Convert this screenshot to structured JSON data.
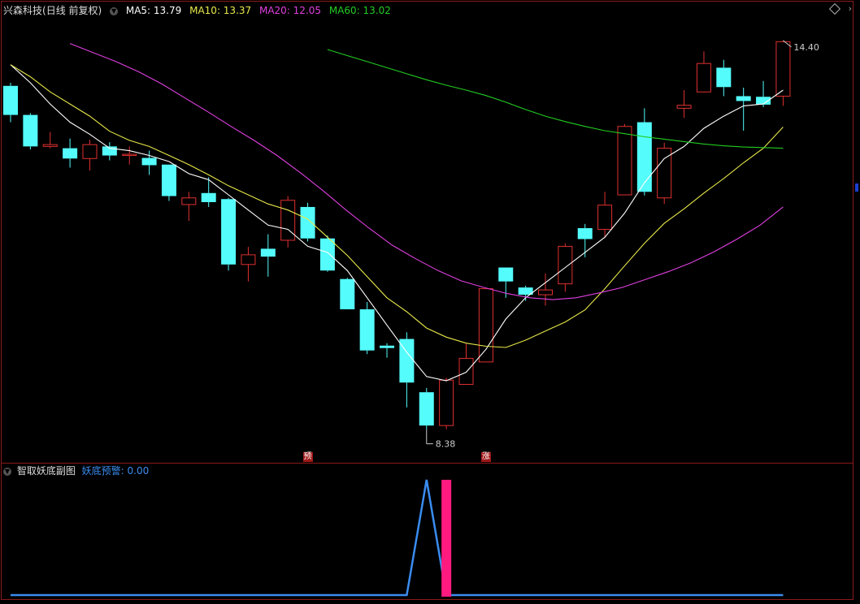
{
  "header": {
    "stock_name": "兴森科技",
    "period": "(日线 前复权)",
    "ma": [
      {
        "label": "MA5: 13.79",
        "color": "#ffffff"
      },
      {
        "label": "MA10: 13.37",
        "color": "#e8e84a"
      },
      {
        "label": "MA20: 12.05",
        "color": "#e040e0"
      },
      {
        "label": "MA60: 13.02",
        "color": "#22cc22"
      }
    ]
  },
  "price_marks": {
    "high": "14.40",
    "low": "8.38"
  },
  "signals": [
    {
      "label": "预",
      "index": 15
    },
    {
      "label": "涨",
      "index": 24
    }
  ],
  "sub_panel": {
    "title": "智取妖底副图",
    "indicator_label": "妖底预警: 0.00",
    "indicator_color": "#3a8cf0"
  },
  "colors": {
    "up": "#e03030",
    "down": "#54fcfc",
    "ma5": "#ffffff",
    "ma10": "#e8e84a",
    "ma20": "#e040e0",
    "ma60": "#22cc22",
    "frame": "#8b1a1a",
    "signal_bar": "#ff1a80"
  },
  "chart_data": {
    "type": "candlestick",
    "ylim": [
      8.0,
      15.2
    ],
    "candles": [
      {
        "o": 14.05,
        "c": 13.57,
        "h": 14.1,
        "l": 13.45
      },
      {
        "o": 13.57,
        "c": 13.05,
        "h": 13.6,
        "l": 13.0
      },
      {
        "o": 13.05,
        "c": 13.08,
        "h": 13.29,
        "l": 13.02
      },
      {
        "o": 13.02,
        "c": 12.85,
        "h": 13.18,
        "l": 12.7
      },
      {
        "o": 12.85,
        "c": 13.08,
        "h": 13.16,
        "l": 12.65
      },
      {
        "o": 13.05,
        "c": 12.9,
        "h": 13.12,
        "l": 12.82
      },
      {
        "o": 12.9,
        "c": 12.92,
        "h": 13.05,
        "l": 12.75
      },
      {
        "o": 12.86,
        "c": 12.74,
        "h": 12.98,
        "l": 12.58
      },
      {
        "o": 12.75,
        "c": 12.23,
        "h": 12.75,
        "l": 12.15
      },
      {
        "o": 12.09,
        "c": 12.2,
        "h": 12.3,
        "l": 11.82
      },
      {
        "o": 12.28,
        "c": 12.13,
        "h": 12.54,
        "l": 12.05
      },
      {
        "o": 12.18,
        "c": 11.1,
        "h": 12.2,
        "l": 11.0
      },
      {
        "o": 11.1,
        "c": 11.26,
        "h": 11.39,
        "l": 10.82
      },
      {
        "o": 11.36,
        "c": 11.23,
        "h": 11.6,
        "l": 10.9
      },
      {
        "o": 11.5,
        "c": 12.16,
        "h": 12.23,
        "l": 11.38
      },
      {
        "o": 12.05,
        "c": 11.53,
        "h": 12.12,
        "l": 11.48
      },
      {
        "o": 11.53,
        "c": 11.0,
        "h": 11.58,
        "l": 10.98
      },
      {
        "o": 10.86,
        "c": 10.36,
        "h": 10.88,
        "l": 10.36
      },
      {
        "o": 10.36,
        "c": 9.68,
        "h": 10.48,
        "l": 9.62
      },
      {
        "o": 9.76,
        "c": 9.72,
        "h": 9.8,
        "l": 9.56
      },
      {
        "o": 9.87,
        "c": 9.15,
        "h": 9.98,
        "l": 8.74
      },
      {
        "o": 8.99,
        "c": 8.44,
        "h": 9.06,
        "l": 8.38
      },
      {
        "o": 8.44,
        "c": 9.19,
        "h": 9.23,
        "l": 8.38
      },
      {
        "o": 9.12,
        "c": 9.55,
        "h": 9.79,
        "l": 9.12
      },
      {
        "o": 9.49,
        "c": 10.7,
        "h": 10.7,
        "l": 9.49
      },
      {
        "o": 11.05,
        "c": 10.82,
        "h": 11.05,
        "l": 10.55
      },
      {
        "o": 10.72,
        "c": 10.6,
        "h": 10.75,
        "l": 10.5
      },
      {
        "o": 10.6,
        "c": 10.68,
        "h": 10.95,
        "l": 10.42
      },
      {
        "o": 10.78,
        "c": 11.4,
        "h": 11.45,
        "l": 10.65
      },
      {
        "o": 11.7,
        "c": 11.52,
        "h": 11.77,
        "l": 11.22
      },
      {
        "o": 11.68,
        "c": 12.08,
        "h": 12.3,
        "l": 11.54
      },
      {
        "o": 12.25,
        "c": 13.38,
        "h": 13.42,
        "l": 12.25
      },
      {
        "o": 13.45,
        "c": 12.3,
        "h": 13.68,
        "l": 12.24
      },
      {
        "o": 12.2,
        "c": 13.02,
        "h": 13.11,
        "l": 12.1
      },
      {
        "o": 13.68,
        "c": 13.73,
        "h": 13.98,
        "l": 13.52
      },
      {
        "o": 13.95,
        "c": 14.42,
        "h": 14.62,
        "l": 13.95
      },
      {
        "o": 14.35,
        "c": 14.03,
        "h": 14.48,
        "l": 13.88
      },
      {
        "o": 13.88,
        "c": 13.8,
        "h": 14.02,
        "l": 13.31
      },
      {
        "o": 13.87,
        "c": 13.74,
        "h": 14.13,
        "l": 13.7
      },
      {
        "o": 13.88,
        "c": 14.78,
        "h": 14.8,
        "l": 13.72
      }
    ],
    "ma5": [
      14.4,
      14.1,
      13.75,
      13.45,
      13.25,
      13.02,
      12.98,
      12.9,
      12.8,
      12.6,
      12.5,
      12.25,
      12.0,
      11.75,
      11.68,
      11.4,
      11.3,
      11.0,
      10.55,
      10.1,
      9.65,
      9.25,
      9.18,
      9.32,
      9.7,
      10.2,
      10.55,
      10.8,
      11.05,
      11.3,
      11.55,
      11.95,
      12.45,
      12.85,
      13.05,
      13.35,
      13.55,
      13.72,
      13.75,
      13.98
    ],
    "ma10": [
      14.4,
      14.2,
      13.95,
      13.75,
      13.55,
      13.3,
      13.15,
      13.05,
      12.9,
      12.75,
      12.58,
      12.4,
      12.25,
      12.1,
      12.0,
      11.85,
      11.55,
      11.25,
      10.9,
      10.55,
      10.32,
      10.05,
      9.9,
      9.8,
      9.75,
      9.73,
      9.85,
      10.0,
      10.15,
      10.35,
      10.7,
      11.08,
      11.45,
      11.78,
      12.02,
      12.28,
      12.52,
      12.78,
      13.02,
      13.37
    ],
    "ma20_x": [
      3,
      39
    ],
    "ma20": [
      14.75,
      14.6,
      14.45,
      14.28,
      14.08,
      13.85,
      13.62,
      13.38,
      13.15,
      12.9,
      12.62,
      12.32,
      12.0,
      11.7,
      11.42,
      11.2,
      11.0,
      10.83,
      10.72,
      10.62,
      10.55,
      10.52,
      10.55,
      10.63,
      10.72,
      10.85,
      10.98,
      11.13,
      11.31,
      11.52,
      11.75,
      12.05
    ],
    "ma60_x": [
      16,
      39
    ],
    "ma60": [
      14.65,
      14.55,
      14.45,
      14.35,
      14.25,
      14.15,
      14.06,
      13.98,
      13.89,
      13.78,
      13.66,
      13.55,
      13.46,
      13.38,
      13.31,
      13.26,
      13.21,
      13.17,
      13.13,
      13.09,
      13.06,
      13.04,
      13.03,
      13.02
    ],
    "sub": {
      "line_values": [
        0,
        0,
        0,
        0,
        0,
        0,
        0,
        0,
        0,
        0,
        0,
        0,
        0,
        0,
        0,
        0,
        0,
        0,
        0,
        0,
        0,
        1,
        0,
        0,
        0,
        0,
        0,
        0,
        0,
        0,
        0,
        0,
        0,
        0,
        0,
        0,
        0,
        0,
        0,
        0
      ],
      "bar_index": 22,
      "bar_value": 1
    }
  }
}
